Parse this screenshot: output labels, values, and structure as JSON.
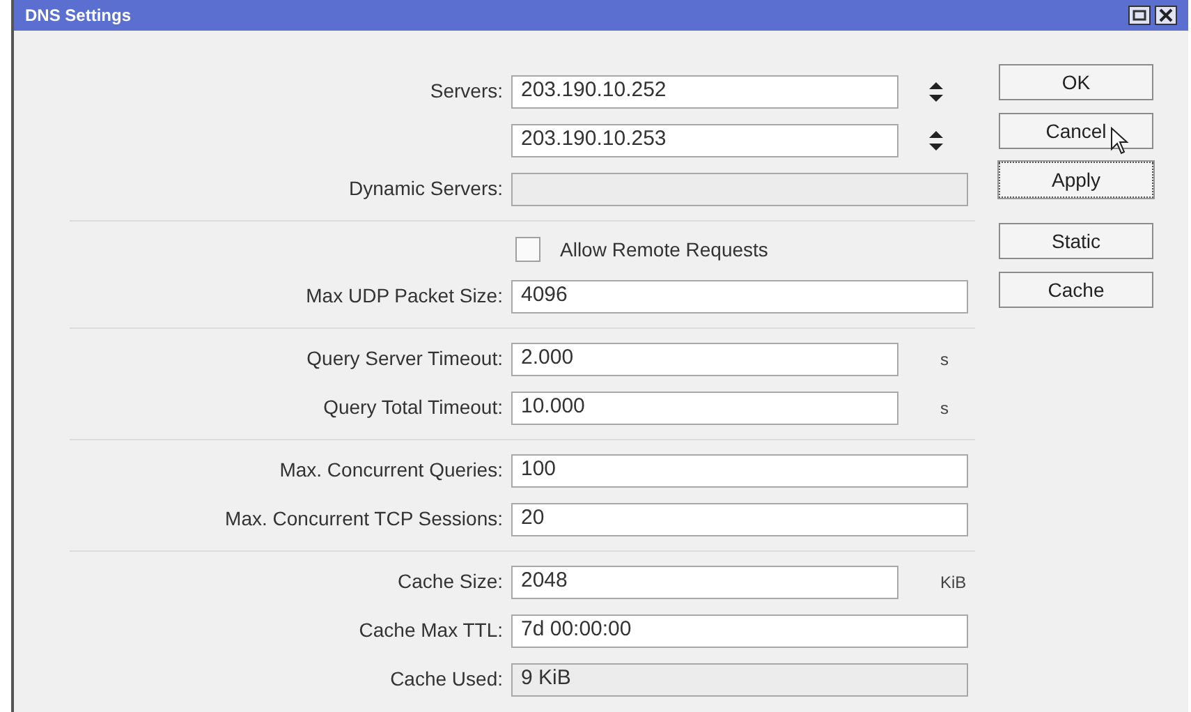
{
  "window": {
    "title": "DNS Settings"
  },
  "rows": [
    {
      "kind": "spin_field",
      "label": "Servers:",
      "value": "203.190.10.252",
      "readonly": false
    },
    {
      "kind": "spin_field",
      "value": "203.190.10.253",
      "readonly": false
    },
    {
      "kind": "field",
      "label": "Dynamic Servers:",
      "readonly": true
    },
    {
      "kind": "separator"
    },
    {
      "kind": "checkbox",
      "label": "Allow Remote Requests",
      "checked": false
    },
    {
      "kind": "field",
      "label": "Max UDP Packet Size:",
      "value": "4096",
      "readonly": false
    },
    {
      "kind": "separator"
    },
    {
      "kind": "field",
      "label": "Query Server Timeout:",
      "value": "2.000",
      "unit": "s",
      "readonly": false
    },
    {
      "kind": "field",
      "label": "Query Total Timeout:",
      "value": "10.000",
      "unit": "s",
      "readonly": false
    },
    {
      "kind": "separator"
    },
    {
      "kind": "field",
      "label": "Max. Concurrent Queries:",
      "value": "100",
      "readonly": false
    },
    {
      "kind": "field",
      "label": "Max. Concurrent TCP Sessions:",
      "value": "20",
      "readonly": false
    },
    {
      "kind": "separator"
    },
    {
      "kind": "field",
      "label": "Cache Size:",
      "value": "2048",
      "unit": "KiB",
      "readonly": false
    },
    {
      "kind": "field",
      "label": "Cache Max TTL:",
      "value": "7d 00:00:00",
      "readonly": false
    },
    {
      "kind": "field",
      "label": "Cache Used:",
      "value": "9 KiB",
      "readonly": true
    }
  ],
  "buttons": [
    {
      "label": "OK",
      "focused": false,
      "pointer": false
    },
    {
      "label": "Cancel",
      "focused": false,
      "pointer": true
    },
    {
      "label": "Apply",
      "focused": true,
      "pointer": false
    },
    {
      "label": "Static",
      "focused": false,
      "pointer": false
    },
    {
      "label": "Cache",
      "focused": false,
      "pointer": false
    }
  ]
}
